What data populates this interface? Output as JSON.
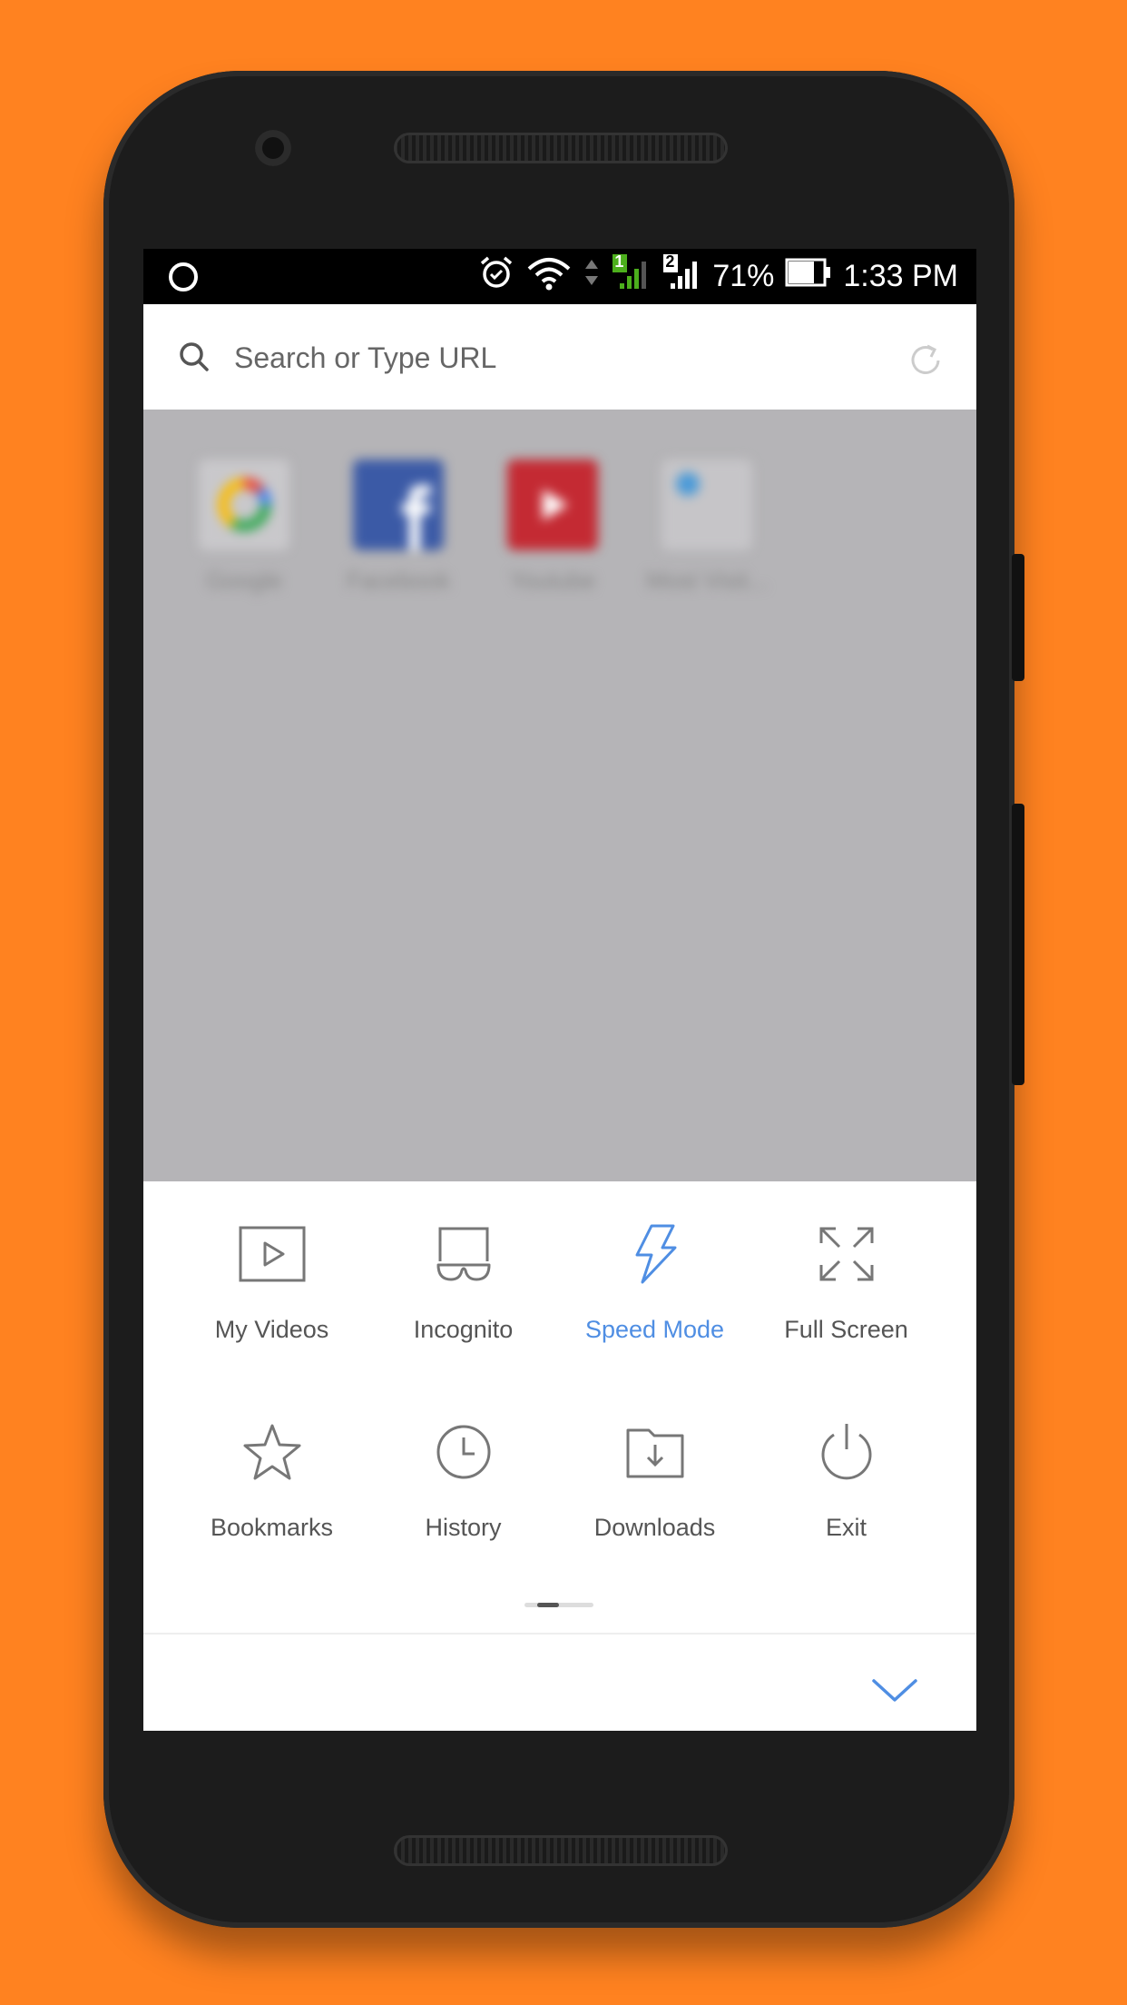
{
  "status_bar": {
    "battery": "71%",
    "time": "1:33 PM",
    "sim_badge_1": "1",
    "sim_badge_2": "2"
  },
  "search": {
    "placeholder": "Search or Type URL"
  },
  "speed_dial": [
    {
      "label": "Google",
      "icon": "google-logo"
    },
    {
      "label": "Facebook",
      "icon": "facebook-logo"
    },
    {
      "label": "Youtube",
      "icon": "youtube-logo"
    },
    {
      "label": "Most Visit...",
      "icon": "most-visited-icon"
    }
  ],
  "menu": {
    "items": [
      {
        "label": "My Videos",
        "icon": "video-icon"
      },
      {
        "label": "Incognito",
        "icon": "incognito-mask-icon"
      },
      {
        "label": "Speed Mode",
        "icon": "lightning-icon",
        "active": true
      },
      {
        "label": "Full Screen",
        "icon": "fullscreen-icon"
      },
      {
        "label": "Bookmarks",
        "icon": "star-icon"
      },
      {
        "label": "History",
        "icon": "clock-icon"
      },
      {
        "label": "Downloads",
        "icon": "download-folder-icon"
      },
      {
        "label": "Exit",
        "icon": "power-icon"
      }
    ]
  },
  "colors": {
    "background": "#FF8220",
    "accent": "#4F8EE3",
    "content_dim": "#B5B4B7"
  }
}
